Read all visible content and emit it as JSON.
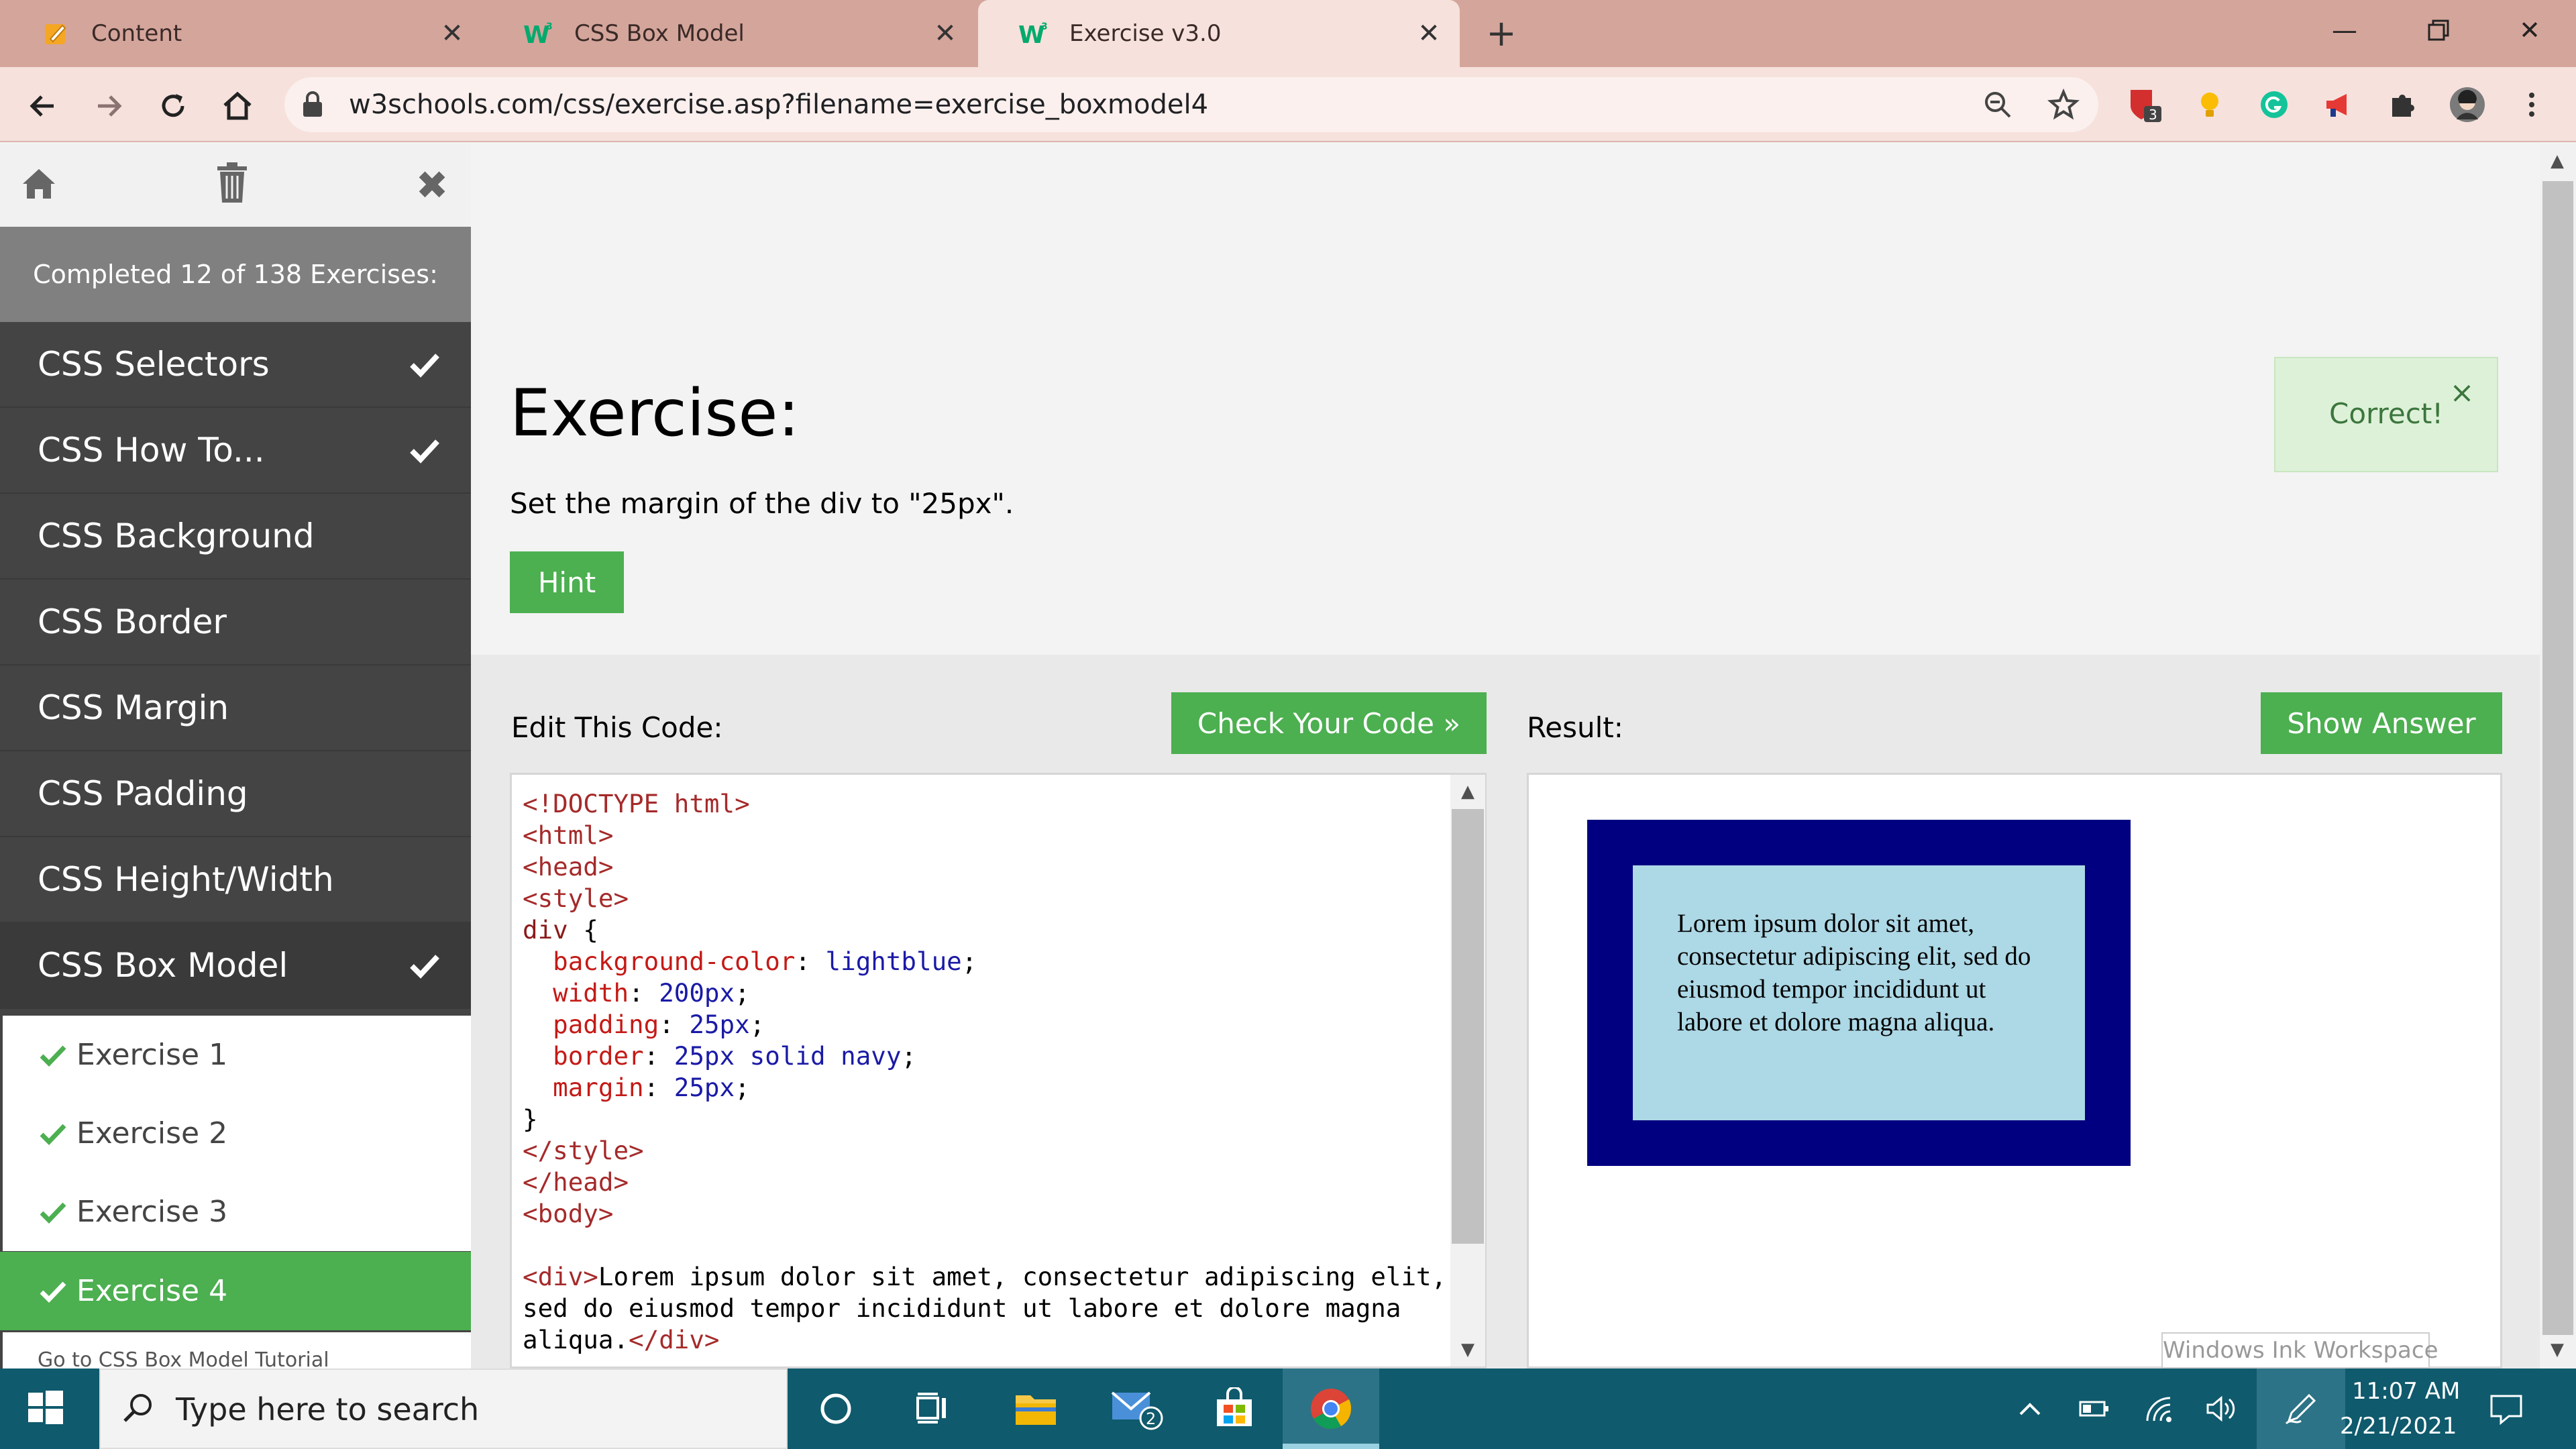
{
  "browser": {
    "tabs": [
      {
        "title": "Content",
        "icon": "pencil-notebook-icon"
      },
      {
        "title": "CSS Box Model",
        "icon": "w3schools-icon"
      },
      {
        "title": "Exercise v3.0",
        "icon": "w3schools-icon",
        "active": true
      }
    ],
    "new_tab_label": "+",
    "url": "w3schools.com/css/exercise.asp?filename=exercise_boxmodel4",
    "window_controls": [
      "minimize-icon",
      "restore-icon",
      "close-icon"
    ],
    "extension_badge": "3"
  },
  "sidebar": {
    "progress": "Completed 12 of 138 Exercises:",
    "sections": [
      {
        "label": "CSS Selectors",
        "done": true
      },
      {
        "label": "CSS How To...",
        "done": true
      },
      {
        "label": "CSS Background",
        "done": false
      },
      {
        "label": "CSS Border",
        "done": false
      },
      {
        "label": "CSS Margin",
        "done": false
      },
      {
        "label": "CSS Padding",
        "done": false
      },
      {
        "label": "CSS Height/Width",
        "done": false
      },
      {
        "label": "CSS Box Model",
        "done": true
      }
    ],
    "exercises": [
      {
        "label": "Exercise 1"
      },
      {
        "label": "Exercise 2"
      },
      {
        "label": "Exercise 3"
      },
      {
        "label": "Exercise 4",
        "current": true
      }
    ],
    "tutorial_link": "Go to CSS Box Model Tutorial"
  },
  "exercise": {
    "title": "Exercise:",
    "instruction": "Set the margin of the div to \"25px\".",
    "hint_label": "Hint",
    "feedback": "Correct!",
    "feedback_close": "×"
  },
  "editor": {
    "label": "Edit This Code:",
    "check_label": "Check Your Code »",
    "code": {
      "l1": "<!DOCTYPE html>",
      "l2": "<html>",
      "l3": "<head>",
      "l4": "<style>",
      "selector": "div",
      "brace_open": " {",
      "props": [
        {
          "name": "background-color",
          "value": "lightblue"
        },
        {
          "name": "width",
          "value": "200px"
        },
        {
          "name": "padding",
          "value": "25px"
        },
        {
          "name": "border",
          "value": "25px solid navy"
        },
        {
          "name": "margin",
          "value": "25px"
        }
      ],
      "brace_close": "}",
      "l_style_close": "</style>",
      "l_head_close": "</head>",
      "l_body": "<body>",
      "div_open": "<div>",
      "div_text_1": "Lorem ipsum dolor sit amet, consectetur adipiscing elit,",
      "div_text_2": "sed do eiusmod tempor incididunt ut labore et dolore magna",
      "div_text_3": "aliqua.",
      "div_close": "</div>"
    }
  },
  "result": {
    "label": "Result:",
    "answer_label": "Show Answer",
    "text": "Lorem ipsum dolor sit amet, consectetur adipiscing elit, sed do eiusmod tempor incididunt ut labore et dolore magna aliqua.",
    "box_colors": {
      "border": "#000080",
      "background": "#add8e6"
    }
  },
  "overlay": {
    "ink_workspace": "Windows Ink Workspace"
  },
  "taskbar": {
    "search_placeholder": "Type here to search",
    "mail_badge": "2",
    "time": "11:07 AM",
    "date": "2/21/2021"
  },
  "colors": {
    "accent": "#4caf50",
    "sidebar": "#444444",
    "tabstrip": "#d4a59b",
    "taskbar": "#0f5a6c"
  }
}
